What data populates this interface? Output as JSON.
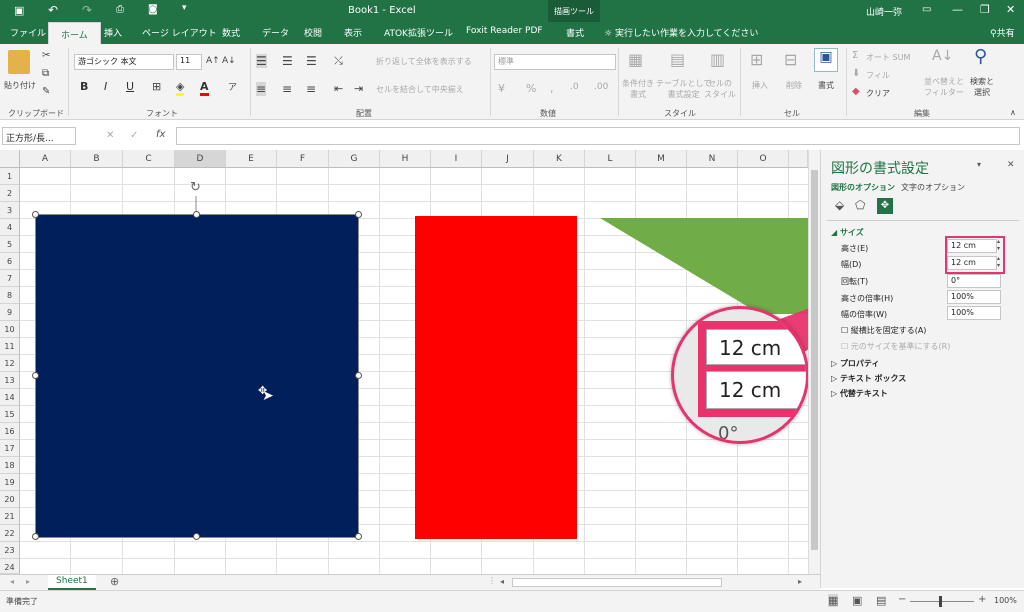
{
  "title": {
    "doc": "Book1 - Excel",
    "context_tab": "描画ツール",
    "user": "山崎一弥"
  },
  "tabs": [
    "ファイル",
    "ホーム",
    "挿入",
    "ページ レイアウト",
    "数式",
    "データ",
    "校閲",
    "表示",
    "ATOK拡張ツール",
    "Foxit Reader PDF",
    "書式"
  ],
  "tell_me": "実行したい作業を入力してください",
  "share": "共有",
  "ribbon": {
    "paste": "貼り付け",
    "clipboard": "クリップボード",
    "font_name": "游ゴシック 本文",
    "font_size": "11",
    "font_group": "フォント",
    "wrap": "折り返して全体を表示する",
    "merge": "セルを結合して中央揃え",
    "align_group": "配置",
    "number_format": "標準",
    "number_group": "数値",
    "cond_format": "条件付き\n書式",
    "as_table": "テーブルとして\n書式設定",
    "cell_style": "セルの\nスタイル",
    "style_group": "スタイル",
    "insert": "挿入",
    "delete": "削除",
    "format": "書式",
    "cell_group": "セル",
    "autosum": "オート SUM",
    "fill": "フィル",
    "clear": "クリア",
    "sort": "並べ替えと\nフィルター",
    "find": "検索と\n選択",
    "edit_group": "編集"
  },
  "formula": {
    "name_box": "正方形/長...",
    "fx": "fx",
    "cancel": "✕",
    "enter": "✓"
  },
  "columns": [
    "A",
    "B",
    "C",
    "D",
    "E",
    "F",
    "G",
    "H",
    "I",
    "J",
    "K",
    "L",
    "M",
    "N",
    "O"
  ],
  "rows": [
    "1",
    "2",
    "3",
    "4",
    "5",
    "6",
    "7",
    "8",
    "9",
    "10",
    "11",
    "12",
    "13",
    "14",
    "15",
    "16",
    "17",
    "18",
    "19",
    "20",
    "21",
    "22",
    "23",
    "24"
  ],
  "pane": {
    "title": "図形の書式設定",
    "tab_shape": "図形のオプション",
    "tab_text": "文字のオプション",
    "section_size": "サイズ",
    "height_label": "高さ(E)",
    "height_value": "12 cm",
    "width_label": "幅(D)",
    "width_value": "12 cm",
    "rotation_label": "回転(T)",
    "rotation_value": "0°",
    "scale_h_label": "高さの倍率(H)",
    "scale_h_value": "100%",
    "scale_w_label": "幅の倍率(W)",
    "scale_w_value": "100%",
    "lock_aspect": "縦横比を固定する(A)",
    "relative": "元のサイズを基準にする(R)",
    "properties": "プロパティ",
    "textbox": "テキスト ボックス",
    "alt_text": "代替テキスト"
  },
  "zoom_callout": {
    "value1": "12 cm",
    "value2": "12 cm",
    "value3": "0°"
  },
  "sheet_tab": "Sheet1",
  "status": {
    "ready": "準備完了",
    "zoom": "100%"
  },
  "colors": {
    "excel_green": "#217346",
    "navy_rect": "#001f5b",
    "red_rect": "#ff0000",
    "green_triangle": "#70ad47",
    "highlight": "#e8336d"
  }
}
